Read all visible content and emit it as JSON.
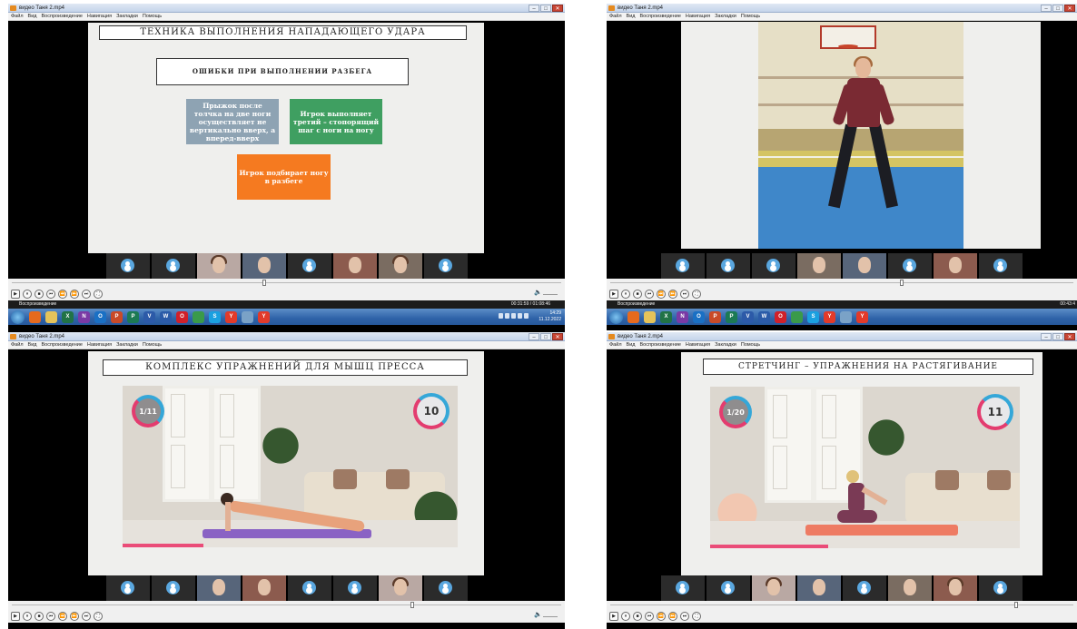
{
  "windows": [
    {
      "title": "видео Таня 2.mp4",
      "menu": [
        "Файл",
        "Вид",
        "Воспроизведение",
        "Навигация",
        "Закладки",
        "Помощь"
      ],
      "slide_title": "ТЕХНИКА ВЫПОЛНЕНИЯ НАПАДАЮЩЕГО УДАРА",
      "subtitle": "ОШИБКИ ПРИ ВЫПОЛНЕНИИ РАЗБЕГА",
      "boxes": [
        "Прыжок после толчка на две ноги осуществляет не вертикально вверх, а вперед-вверх",
        "Игрок выполняет третий – стопорящий шаг с ноги на ногу",
        "Игрок подбирает ногу в разбеге"
      ],
      "status_label": "Воспроизведение",
      "status_time": "00:31:59 / 01:08:46",
      "clock_time": "14:29",
      "clock_date": "11.12.2022",
      "lang": "RU",
      "seek_fraction": 0.46
    },
    {
      "title": "видео Таня 2.mp4",
      "menu": [
        "Файл",
        "Вид",
        "Воспроизведение",
        "Навигация",
        "Закладки",
        "Помощь"
      ],
      "status_label": "Воспроизведение",
      "status_time": "00:43:4",
      "seek_fraction": 0.63
    },
    {
      "title": "видео Таня 2.mp4",
      "menu": [
        "Файл",
        "Вид",
        "Воспроизведение",
        "Навигация",
        "Закладки",
        "Помощь"
      ],
      "slide_title": "КОМПЛЕКС УПРАЖНЕНИЙ ДЛЯ МЫШЦ ПРЕССА",
      "counter_left": "1/11",
      "counter_right": "10",
      "progress_fraction": 0.24,
      "seek_fraction": 0.73
    },
    {
      "title": "видео Таня 2.mp4",
      "menu": [
        "Файл",
        "Вид",
        "Воспроизведение",
        "Навигация",
        "Закладки",
        "Помощь"
      ],
      "slide_title": "СТРЕТЧИНГ – УПРАЖНЕНИЯ НА РАСТЯГИВАНИЕ",
      "counter_left": "1/20",
      "counter_right": "11",
      "progress_fraction": 0.38,
      "seek_fraction": 0.88
    }
  ],
  "icons": {
    "play": "▶",
    "pause": "⏸",
    "stop": "■",
    "prev": "⏮",
    "rewind": "⏪",
    "forward": "⏩",
    "next": "⏭",
    "fullscreen": "⛶",
    "minimize": "–",
    "maximize": "□",
    "close": "✕",
    "speaker": "🔈"
  },
  "taskbar_apps": [
    {
      "name": "firefox",
      "label": "",
      "color": "#e66a1e"
    },
    {
      "name": "explorer",
      "label": "",
      "color": "#e5c35a"
    },
    {
      "name": "excel",
      "label": "X",
      "color": "#217346"
    },
    {
      "name": "onenote",
      "label": "N",
      "color": "#7a3aa5"
    },
    {
      "name": "outlook",
      "label": "O",
      "color": "#1a70c4"
    },
    {
      "name": "powerpoint",
      "label": "P",
      "color": "#c94a28"
    },
    {
      "name": "publisher",
      "label": "P",
      "color": "#1c7a54"
    },
    {
      "name": "visio",
      "label": "V",
      "color": "#2c5aa8"
    },
    {
      "name": "word",
      "label": "W",
      "color": "#2b5ba8"
    },
    {
      "name": "opera",
      "label": "O",
      "color": "#d0202a"
    },
    {
      "name": "chrome",
      "label": "",
      "color": "#3a9a4a"
    },
    {
      "name": "skype",
      "label": "S",
      "color": "#1aa0e0"
    },
    {
      "name": "yandex",
      "label": "Y",
      "color": "#e23a2a"
    },
    {
      "name": "gallery",
      "label": "",
      "color": "#7aa2c7"
    },
    {
      "name": "yandex-browser",
      "label": "Y",
      "color": "#e23a2a"
    }
  ]
}
